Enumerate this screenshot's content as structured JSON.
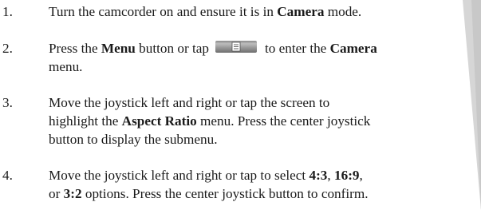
{
  "steps": [
    {
      "number": "1.",
      "segments": [
        {
          "t": "Turn the camcorder on and ensure it is in "
        },
        {
          "t": "Camera",
          "b": true
        },
        {
          "t": " mode."
        }
      ]
    },
    {
      "number": "2.",
      "line1_a": "Press the ",
      "line1_b": "Menu",
      "line1_c": " button or tap",
      "icon": "menu-icon",
      "line1_d": "to enter the ",
      "line1_e": "Camera",
      "line2": "menu."
    },
    {
      "number": "3.",
      "line1": "Move the joystick left and right or tap the screen to",
      "line2_a": "highlight the ",
      "line2_b": "Aspect Ratio",
      "line2_c": " menu. Press the center joystick",
      "line3": "button to display the submenu."
    },
    {
      "number": "4.",
      "line1_a": "Move the joystick left and right or tap to select ",
      "line1_b": "4:3",
      "line1_c": ", ",
      "line1_d": "16:9",
      "line1_e": ",",
      "line2_a": "or ",
      "line2_b": "3:2",
      "line2_c": " options. Press the center joystick button to confirm."
    }
  ]
}
